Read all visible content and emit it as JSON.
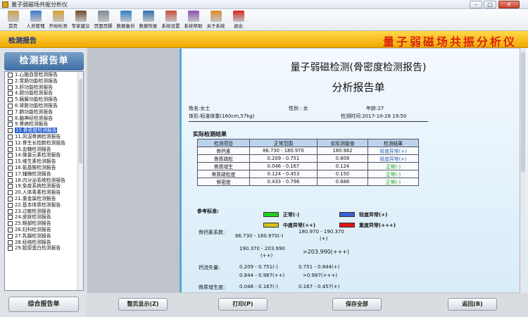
{
  "window": {
    "title": "量子弱磁场共振分析仪",
    "min": "–",
    "max": "□",
    "close": "✕"
  },
  "toolbar": [
    {
      "label": "首页",
      "icon": "home-icon",
      "color": "#c7a24a"
    },
    {
      "label": "人员管理",
      "icon": "people-icon",
      "color": "#3b78c9"
    },
    {
      "label": "开始检测",
      "icon": "hand-icon",
      "color": "#d8a030"
    },
    {
      "label": "专家建议",
      "icon": "expert-icon",
      "color": "#6b4b2a"
    },
    {
      "label": "页面页脚",
      "icon": "page-icon",
      "color": "#7a8a99"
    },
    {
      "label": "数据备份",
      "icon": "backup-icon",
      "color": "#2e7fc4"
    },
    {
      "label": "数据恢复",
      "icon": "restore-icon",
      "color": "#2a6fb0"
    },
    {
      "label": "系统设置",
      "icon": "settings-icon",
      "color": "#c94c3b"
    },
    {
      "label": "系统帮助",
      "icon": "help-icon",
      "color": "#8a4fb6"
    },
    {
      "label": "关于系统",
      "icon": "about-icon",
      "color": "#d98c2a"
    },
    {
      "label": "退出",
      "icon": "exit-icon",
      "color": "#d6241a"
    }
  ],
  "header": {
    "module": "检测报告",
    "brand": "量子弱磁场共振分析仪"
  },
  "sidebar": {
    "title": "检测报告单",
    "items": [
      "1.心脑血管检测报告",
      "2.胃肠功能检测报告",
      "3.肝功能检测报告",
      "4.胆功能检测报告",
      "5.胰腺功能检测报告",
      "6.肾脏功能检测报告",
      "7.肺功能检测报告",
      "8.脑神经检测报告",
      "9.骨病检测报告",
      "10.骨密度检测报告",
      "11.风湿骨病检测报告",
      "12.骨生长指数检测报告",
      "13.血糖检测报告",
      "14.微量元素检测报告",
      "15.维生素检测报告",
      "16.氨基酸检测报告",
      "17.辅酶检测报告",
      "18.内分泌系统检测报告",
      "19.免疫系统检测报告",
      "20.人体毒素检测报告",
      "21.重金属检测报告",
      "22.基本体质检测报告",
      "23.过敏检测报告",
      "24.皮肤检测报告",
      "25.眼部检测报告",
      "26.妇科检测报告",
      "27.乳腺检测报告",
      "28.经络检测报告",
      "29.胶原蛋白检测报告"
    ],
    "selected_index": 9,
    "summary_button": "综合报告单"
  },
  "report": {
    "title": "量子弱磁检测(骨密度检测报告)",
    "subtitle": "分析报告单",
    "name": "姓名:女士",
    "gender": "性别 : 女",
    "age": "年龄:27",
    "body": "体形:标准体重(160cm,57kg)",
    "time": "检测时间:2017-10-28 19:50",
    "section": "实际检测结果",
    "columns": [
      "检测项目",
      "正常范围",
      "实际测量值",
      "检测结果"
    ],
    "rows": [
      [
        "骨钙素",
        "86.730 - 180.970",
        "180.982",
        "轻度异常(+)",
        "mild"
      ],
      [
        "骨质疏松",
        "0.209 - 0.751",
        "0.809",
        "轻度异常(+)",
        "mild"
      ],
      [
        "骨质增生",
        "0.046 - 0.167",
        "0.124",
        "正常(-)",
        "norm"
      ],
      [
        "骨质疏松度",
        "0.124 - 0.453",
        "0.150",
        "正常(-)",
        "norm"
      ],
      [
        "骨密度",
        "0.433 - 0.796",
        "0.688",
        "正常(-)",
        "norm"
      ]
    ],
    "ref_label": "参考标准:",
    "legend": [
      {
        "text": "正常(-)",
        "color": "#1fd11f"
      },
      {
        "text": "轻度异常(+)",
        "color": "#3b5fd6"
      },
      {
        "text": "中度异常(++)",
        "color": "#d8c21a"
      },
      {
        "text": "重度异常(+++)",
        "color": "#e01515"
      }
    ],
    "ref": {
      "item1": "骨钙素系数:",
      "r1a": "86.730 - 180.970(-)",
      "r1b": "180.970 - 190.370",
      "r1b2": "(+)",
      "r1c": "190.370 - 203.990",
      "r1c2": "(++)",
      "r1d": ">203.990(+++)",
      "item2": "钙流失量:",
      "r2a": "0.209 - 0.751(-)",
      "r2b": "0.751 - 0.844(+)",
      "r2c": "0.844 - 0.987(++)",
      "r2d": ">0.987(+++)",
      "item3": "骨质增生度:",
      "r3a": "0.046 - 0.167(-)",
      "r3b": "0.167 - 0.457(+)"
    }
  },
  "buttons": {
    "full": "整页显示(Z)",
    "print": "打印(P)",
    "save": "保存全部",
    "back": "返回(B)"
  }
}
